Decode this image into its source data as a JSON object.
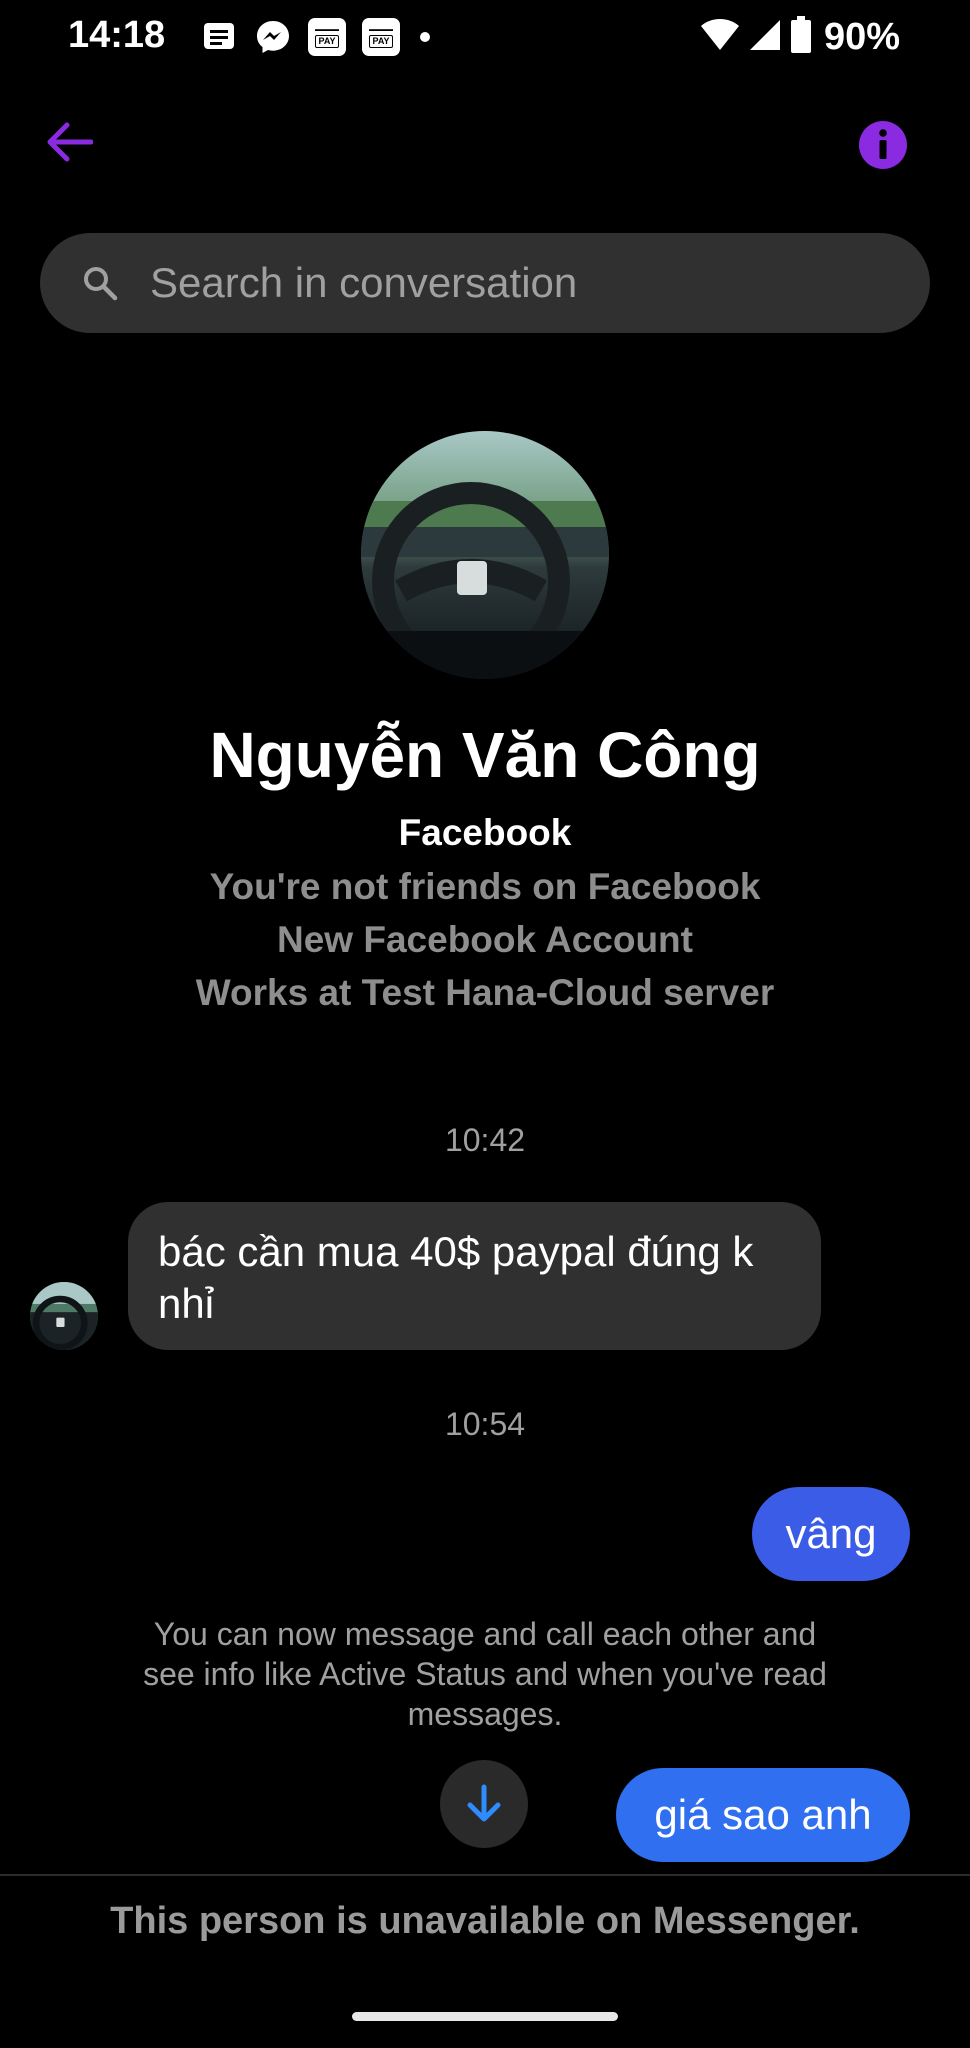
{
  "status_bar": {
    "time": "14:18",
    "notification_icons": [
      "message-notification-icon",
      "messenger-icon",
      "pay-icon",
      "pay-icon",
      "more-notifications-dot"
    ],
    "pay_icon_text": "PAY",
    "battery_percent": "90%",
    "icons": [
      "wifi-icon",
      "signal-icon",
      "battery-icon"
    ]
  },
  "header": {
    "back_icon": "arrow-left-icon",
    "info_icon": "info-icon",
    "accent_color": "#8a2be2"
  },
  "search": {
    "placeholder": "Search in conversation"
  },
  "profile": {
    "name": "Nguyễn Văn Công",
    "source": "Facebook",
    "lines": [
      "You're not friends on Facebook",
      "New Facebook Account",
      "Works at Test Hana-Cloud server"
    ]
  },
  "conversation": {
    "timestamp_1": "10:42",
    "incoming_message": "bác cần mua 40$ paypal đúng k nhỉ",
    "timestamp_2": "10:54",
    "outgoing_message_1": "vâng",
    "system_note": "You can now message and call each other and see info like Active Status and when you've read messages.",
    "outgoing_message_2": "giá sao anh"
  },
  "footer": {
    "unavailable_text": "This person is unavailable on Messenger."
  }
}
